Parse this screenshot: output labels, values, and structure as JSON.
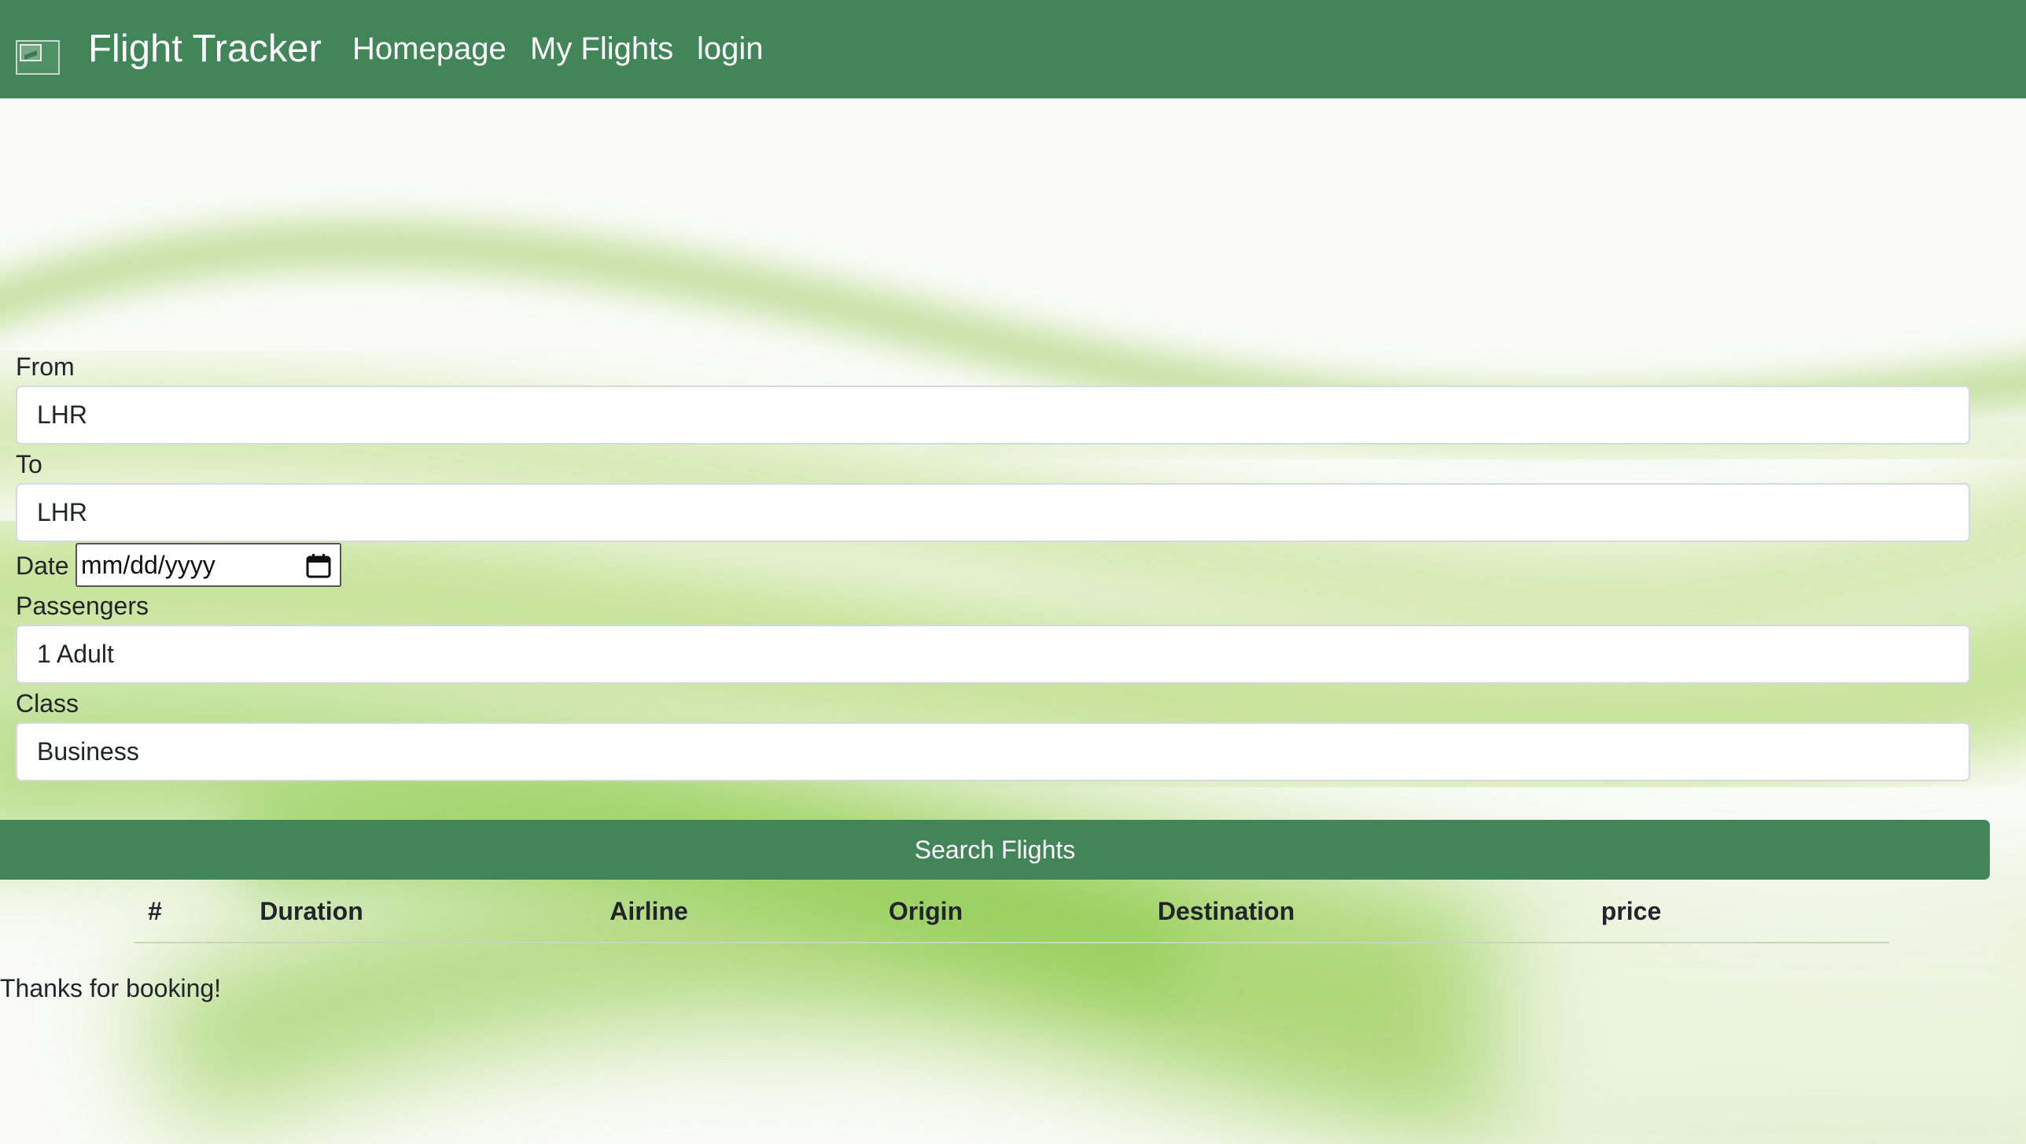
{
  "navbar": {
    "brand": "Flight Tracker",
    "links": [
      "Homepage",
      "My Flights",
      "login"
    ]
  },
  "form": {
    "from_label": "From",
    "from_value": "LHR",
    "to_label": "To",
    "to_value": "LHR",
    "date_label": "Date",
    "date_placeholder": "mm/dd/yyyy",
    "passengers_label": "Passengers",
    "passengers_value": "1 Adult",
    "class_label": "Class",
    "class_value": "Business",
    "search_button": "Search Flights"
  },
  "results_table": {
    "headers": [
      "#",
      "Duration",
      "Airline",
      "Origin",
      "Destination",
      "price"
    ]
  },
  "footer_message": "Thanks for booking!",
  "colors": {
    "accent": "#418559"
  }
}
